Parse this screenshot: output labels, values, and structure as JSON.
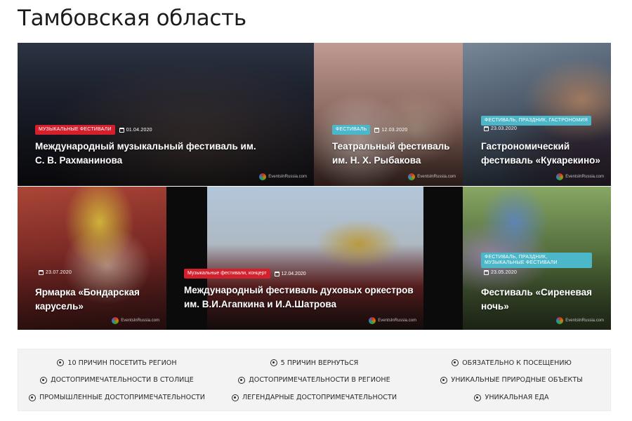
{
  "page": {
    "title": "Тамбовская область"
  },
  "tiles": [
    {
      "badge": "Музыкальные фестивали",
      "date": "01.04.2020",
      "title": "Международный музыкальный фестиваль им. С. В. Рахманинова",
      "badge_color": "#d4202c",
      "watermark": "EventsInRussia.com"
    },
    {
      "badge": "Фестиваль",
      "date": "12.03.2020",
      "title": "Театральный фестиваль им. Н. Х. Рыбакова",
      "badge_color": "#4bb7c9",
      "watermark": "EventsInRussia.com"
    },
    {
      "badge": "Фестиваль, праздник, гастрономия",
      "date": "23.03.2020",
      "title": "Гастрономический фестиваль «Кукарекино»",
      "badge_color": "#4bb7c9",
      "watermark": "EventsInRussia.com"
    },
    {
      "badge": "",
      "date": "23.07.2020",
      "title": "Ярмарка «Бондарская карусель»",
      "badge_color": "#4bb7c9",
      "watermark": "EventsInRussia.com"
    },
    {
      "badge": "Музыкальные фестивали, концерт",
      "date": "12.04.2020",
      "title": "Международный фестиваль духовых оркестров им. В.И.Агапкина и И.А.Шатрова",
      "badge_color": "#d4202c",
      "watermark": "EventsInRussia.com"
    },
    {
      "badge": "Фестиваль, праздник, музыкальные фестивали",
      "date": "23.05.2020",
      "title": "Фестиваль «Сиреневая ночь»",
      "badge_color": "#4bb7c9",
      "watermark": "EventsInRussia.com"
    }
  ],
  "links": [
    {
      "label": "10 причин посетить регион",
      "icon": "location-dot-icon"
    },
    {
      "label": "5 причин вернуться",
      "icon": "location-dot-icon"
    },
    {
      "label": "Обязательно к посещению",
      "icon": "location-dot-icon"
    },
    {
      "label": "Достопримечательности в столице",
      "icon": "location-dot-icon"
    },
    {
      "label": "Достопримечательности в регионе",
      "icon": "location-dot-icon"
    },
    {
      "label": "Уникальные природные объекты",
      "icon": "location-dot-icon"
    },
    {
      "label": "Промышленные достопримечательности",
      "icon": "location-dot-icon"
    },
    {
      "label": "Легендарные достопримечательности",
      "icon": "location-dot-icon"
    },
    {
      "label": "Уникальная еда",
      "icon": "location-dot-icon"
    }
  ]
}
